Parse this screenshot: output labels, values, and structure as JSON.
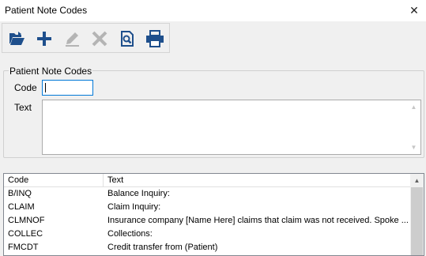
{
  "window": {
    "title": "Patient Note Codes",
    "close_glyph": "✕"
  },
  "toolbar": {
    "buttons": [
      {
        "name": "open-icon",
        "enabled": true
      },
      {
        "name": "add-icon",
        "enabled": true
      },
      {
        "name": "edit-icon",
        "enabled": false
      },
      {
        "name": "delete-icon",
        "enabled": false
      },
      {
        "name": "search-icon",
        "enabled": true
      },
      {
        "name": "print-icon",
        "enabled": true
      }
    ],
    "colors": {
      "enabled": "#1e4f8c",
      "disabled": "#b4b4b4"
    }
  },
  "form": {
    "group_label": "Patient Note Codes",
    "code_label": "Code",
    "code_value": "",
    "text_label": "Text",
    "text_value": ""
  },
  "grid": {
    "columns": [
      "Code",
      "Text"
    ],
    "rows": [
      {
        "code": "B/INQ",
        "text": "Balance Inquiry:"
      },
      {
        "code": "CLAIM",
        "text": "Claim Inquiry:"
      },
      {
        "code": "CLMNOF",
        "text": "Insurance company [Name Here] claims that claim was not received.  Spoke ..."
      },
      {
        "code": "COLLEC",
        "text": "Collections:"
      },
      {
        "code": "FMCDT",
        "text": "Credit transfer from (Patient)"
      }
    ]
  }
}
